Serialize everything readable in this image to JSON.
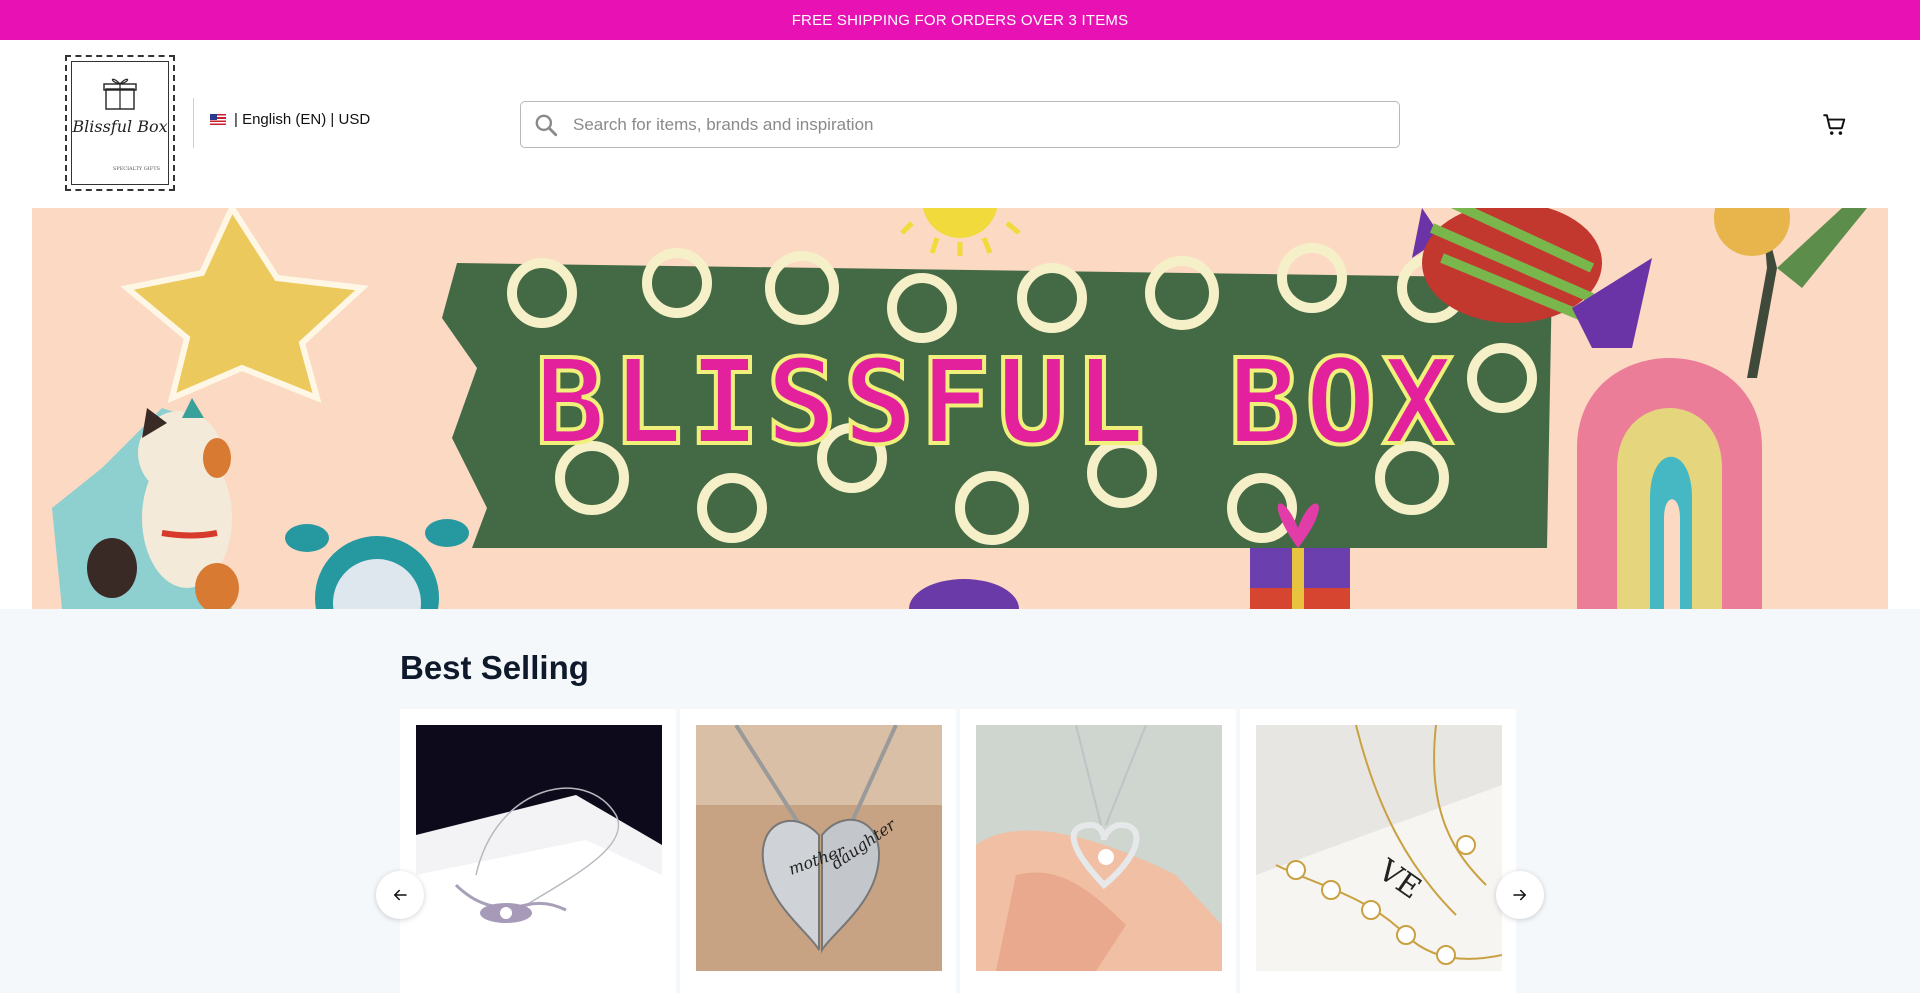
{
  "announcement": {
    "text": "FREE SHIPPING FOR ORDERS OVER 3 ITEMS"
  },
  "header": {
    "logo": {
      "script_text": "Blissful Box",
      "small_text": "SPECIALTY GIFTS"
    },
    "locale": {
      "label": "| English (EN) | USD"
    },
    "search": {
      "placeholder": "Search for items, brands and inspiration"
    },
    "cart_icon": "cart-icon"
  },
  "banner": {
    "headline": "BLISSFUL BOX"
  },
  "best_selling": {
    "title": "Best Selling",
    "products": [
      {
        "image": "silver-necklace-in-box"
      },
      {
        "image": "mother-daughter-heart-necklace"
      },
      {
        "image": "silver-heart-pendant"
      },
      {
        "image": "gold-clover-jewelry-set"
      }
    ]
  },
  "colors": {
    "accent": "#e812b4",
    "banner_bg": "#fbd9c2",
    "banner_green": "#436a45",
    "section_bg": "#f5f8fb"
  }
}
